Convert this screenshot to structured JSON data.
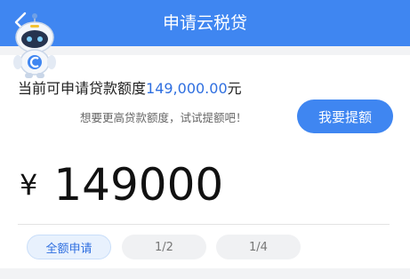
{
  "header": {
    "title": "申请云税贷",
    "back_icon": "chevron-left-icon",
    "bg_color": "#3f86f1"
  },
  "mascot": {
    "icon": "robot-mascot-icon"
  },
  "limit": {
    "prefix": "当前可申请贷款额度",
    "amount": "149,000.00",
    "unit": "元"
  },
  "hint_text": "想要更高贷款额度，试试提额吧！",
  "raise_button_label": "我要提额",
  "loan_amount": {
    "currency_symbol": "¥",
    "value": "149000"
  },
  "quick_select": [
    {
      "label": "全额申请",
      "selected": true
    },
    {
      "label": "1/2",
      "selected": false
    },
    {
      "label": "1/4",
      "selected": false
    }
  ],
  "colors": {
    "accent": "#3f86f1",
    "amount_text": "#2f6fe0"
  }
}
